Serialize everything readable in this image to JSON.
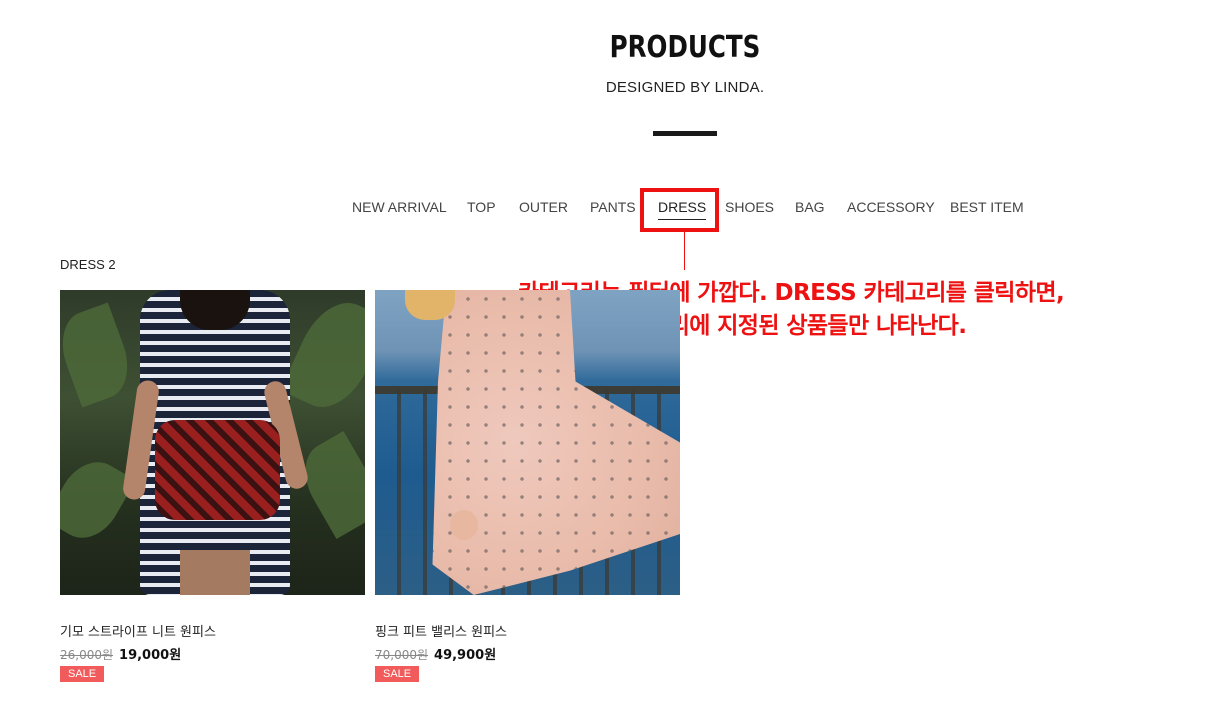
{
  "header": {
    "title": "PRODUCTS",
    "subtitle": "DESIGNED BY LINDA."
  },
  "categories": [
    {
      "label": "NEW ARRIVAL",
      "active": false
    },
    {
      "label": "TOP",
      "active": false
    },
    {
      "label": "OUTER",
      "active": false
    },
    {
      "label": "PANTS",
      "active": false
    },
    {
      "label": "DRESS",
      "active": true
    },
    {
      "label": "SHOES",
      "active": false
    },
    {
      "label": "BAG",
      "active": false
    },
    {
      "label": "ACCESSORY",
      "active": false
    },
    {
      "label": "BEST ITEM",
      "active": false
    }
  ],
  "annotation": {
    "line1": "카테고리는 필터에 가깝다. DRESS 카테고리를 클릭하면,",
    "line2": "DRESS 카테고리에 지정된 상품들만 나타난다.",
    "color": "#ee1111"
  },
  "listing": {
    "count_label": "DRESS 2"
  },
  "products": [
    {
      "name": "기모 스트라이프 니트 원피스",
      "old_price": "26,000원",
      "price": "19,000원",
      "badge": "SALE"
    },
    {
      "name": "핑크 피트 밸리스 원피스",
      "old_price": "70,000원",
      "price": "49,900원",
      "badge": "SALE"
    }
  ],
  "colors": {
    "accent": "#ee1111",
    "sale_badge": "#f15b5b",
    "title_bar": "#1a1a1a"
  }
}
